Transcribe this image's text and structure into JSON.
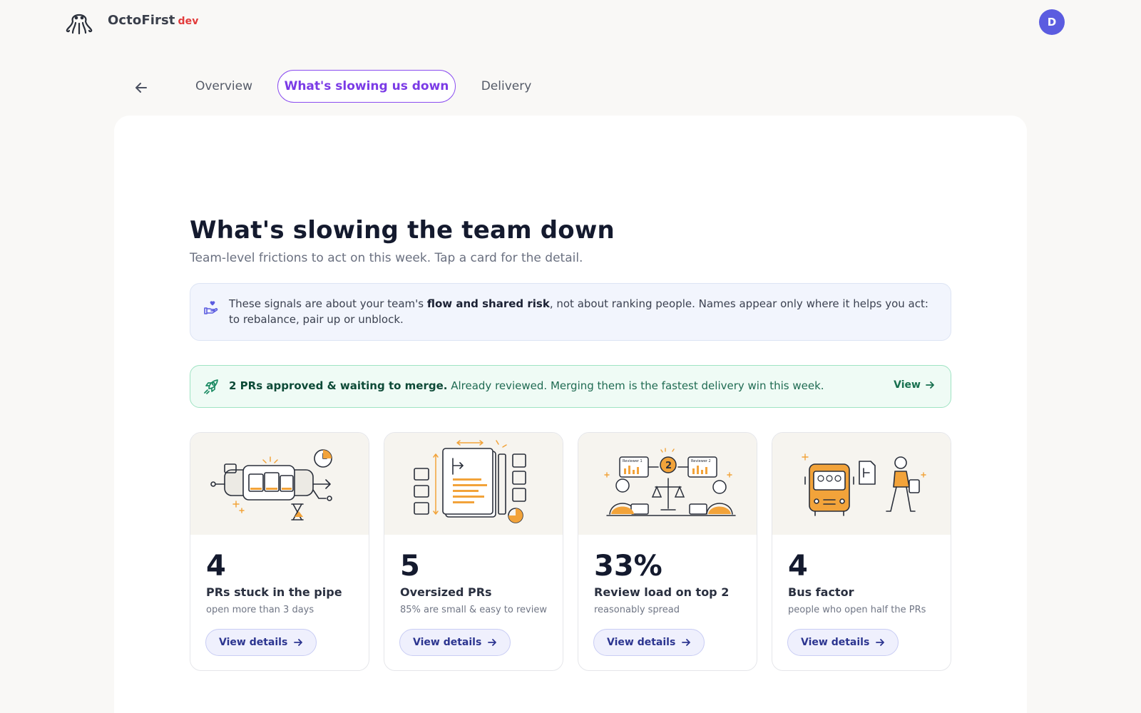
{
  "header": {
    "brand": "OctoFirst",
    "env": "dev",
    "avatar_initial": "D",
    "logo_icon": "octopus-logo-icon"
  },
  "tabs": [
    {
      "label": "Overview",
      "active": false
    },
    {
      "label": "What's slowing us down",
      "active": true
    },
    {
      "label": "Delivery",
      "active": false
    }
  ],
  "page": {
    "title": "What's slowing the team down",
    "subtitle": "Team-level frictions to act on this week. Tap a card for the detail."
  },
  "notice": {
    "icon": "heart-hand-icon",
    "before": "These signals are about your team's ",
    "bold": "flow and shared risk",
    "after": ", not about ranking people. Names appear only where it helps you act: to rebalance, pair up or unblock."
  },
  "win": {
    "icon": "rocket-icon",
    "bold": "2 PRs approved & waiting to merge.",
    "text": " Already reviewed. Merging them is the fastest delivery win this week.",
    "view_label": "View"
  },
  "cards": [
    {
      "value": "4",
      "label": "PRs stuck in the pipe",
      "desc": "open more than 3 days",
      "button": "View details",
      "illustration": "pipe-illustration"
    },
    {
      "value": "5",
      "label": "Oversized PRs",
      "desc": "85% are small & easy to review",
      "button": "View details",
      "illustration": "oversized-doc-illustration"
    },
    {
      "value": "33%",
      "label": "Review load on top 2",
      "desc": "reasonably spread",
      "button": "View details",
      "illustration": "reviewers-scale-illustration",
      "illustration_labels": [
        "Reviewer 1",
        "2",
        "Reviewer 2"
      ]
    },
    {
      "value": "4",
      "label": "Bus factor",
      "desc": "people who open half the PRs",
      "button": "View details",
      "illustration": "bus-illustration"
    }
  ],
  "colors": {
    "accent": "#7b3be6",
    "avatar": "#5b5ce0",
    "env": "#e23a3a",
    "success": "#18704f",
    "illustration_orange": "#f2a33a"
  }
}
